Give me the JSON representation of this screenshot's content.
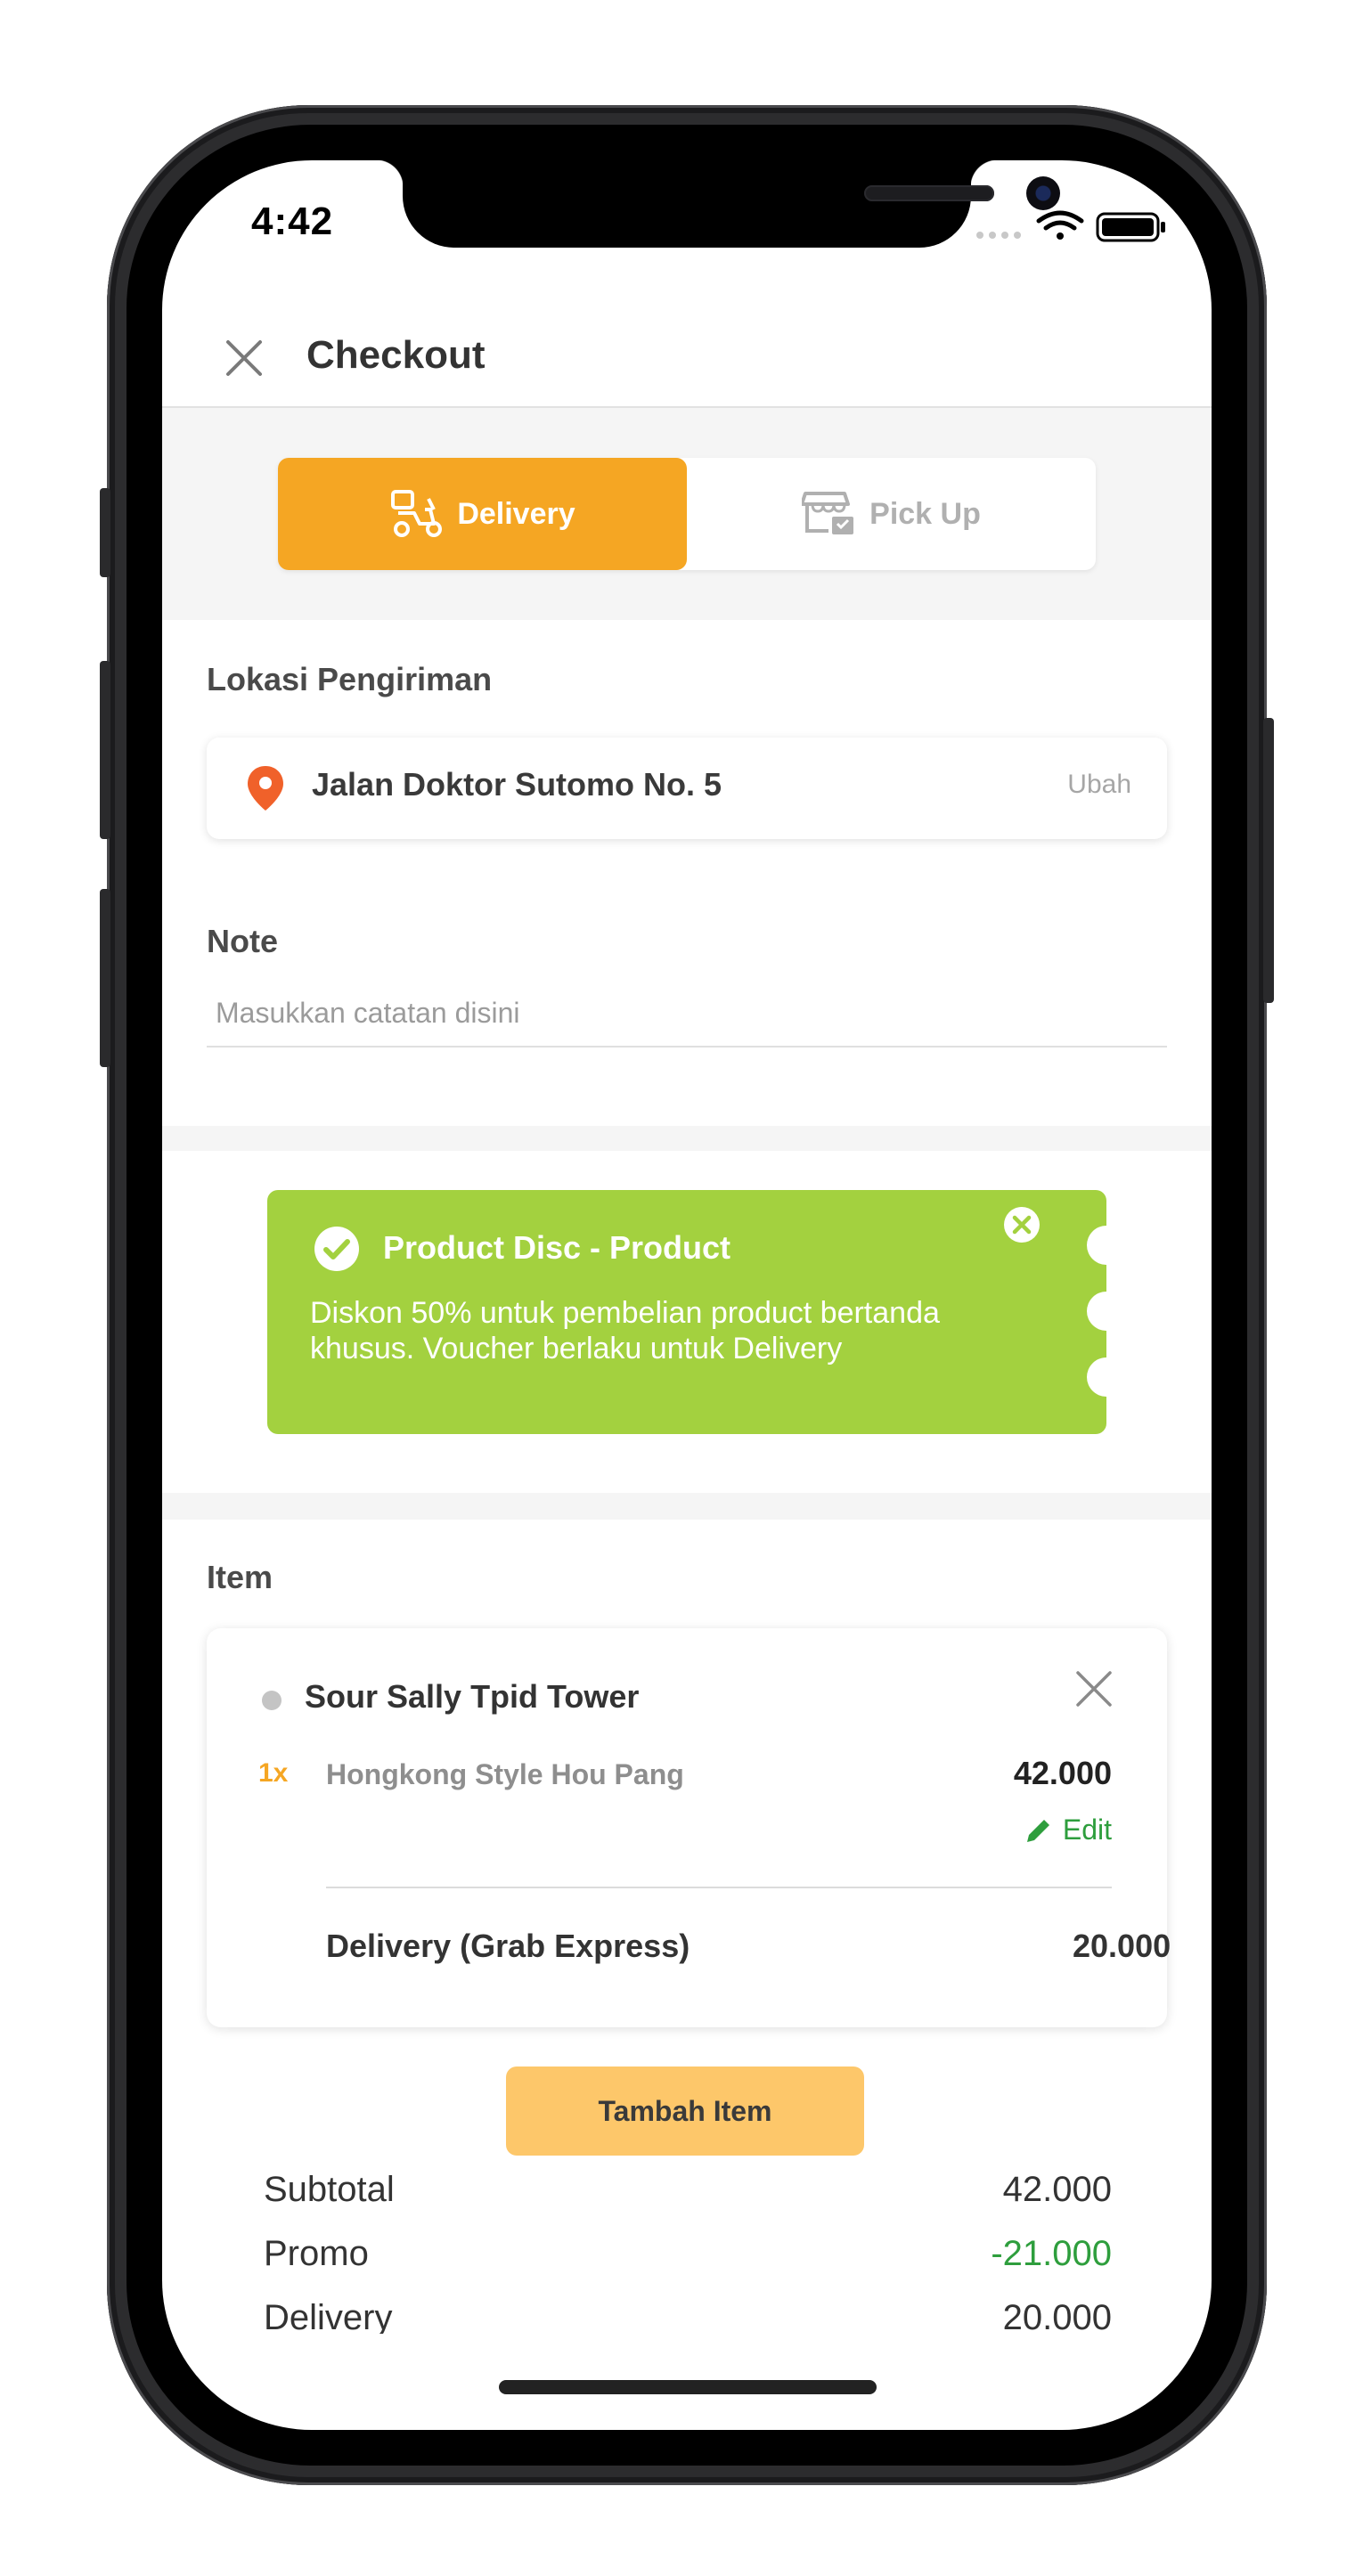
{
  "status_bar": {
    "time": "4:42"
  },
  "header": {
    "title": "Checkout",
    "close_icon": "close-icon"
  },
  "delivery_toggle": {
    "options": [
      {
        "label": "Delivery",
        "icon": "scooter-icon",
        "active": true
      },
      {
        "label": "Pick Up",
        "icon": "store-icon",
        "active": false
      }
    ],
    "active_color": "#f5a623"
  },
  "location": {
    "section_label": "Lokasi Pengiriman",
    "address": "Jalan Doktor Sutomo No. 5",
    "change_label": "Ubah",
    "pin_color": "#f0612a"
  },
  "note": {
    "section_label": "Note",
    "placeholder": "Masukkan catatan disini",
    "value": ""
  },
  "voucher": {
    "title": "Product Disc - Product",
    "description": "Diskon 50% untuk pembelian product bertanda khusus. Voucher berlaku untuk Delivery",
    "color": "#a3d13f"
  },
  "items": {
    "section_label": "Item",
    "store_name": "Sour Sally Tpid Tower",
    "lines": [
      {
        "qty": "1x",
        "name": "Hongkong Style Hou Pang",
        "price": "42.000",
        "edit_label": "Edit"
      }
    ],
    "delivery": {
      "label": "Delivery (Grab Express)",
      "price": "20.000"
    },
    "add_button_label": "Tambah Item"
  },
  "summary": {
    "rows": [
      {
        "label": "Subtotal",
        "value": "42.000"
      },
      {
        "label": "Promo",
        "value": "-21.000",
        "value_color": "#2e9e3d"
      },
      {
        "label": "Delivery",
        "value": "20.000"
      }
    ]
  }
}
